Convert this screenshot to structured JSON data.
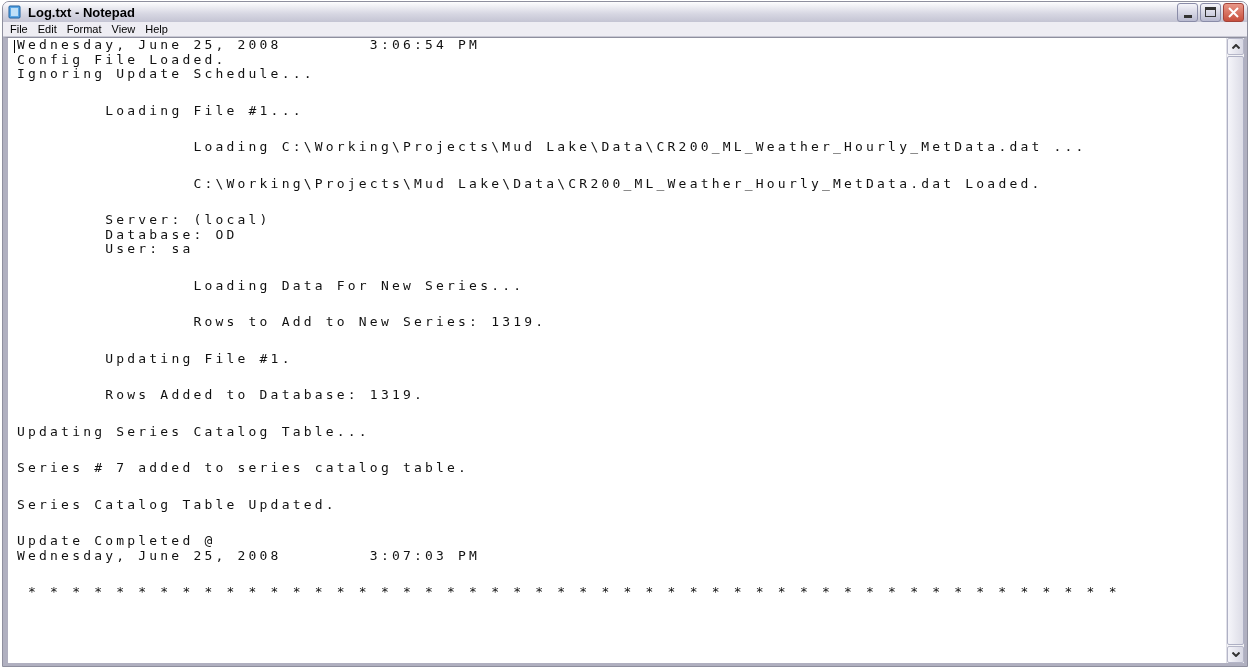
{
  "window": {
    "title": "Log.txt - Notepad"
  },
  "menu": [
    {
      "label": "File"
    },
    {
      "label": "Edit"
    },
    {
      "label": "Format"
    },
    {
      "label": "View"
    },
    {
      "label": "Help"
    }
  ],
  "document": {
    "paragraphs": [
      [
        "Wednesday, June 25, 2008\t3:06:54 PM",
        "Config File Loaded.",
        "Ignoring Update Schedule..."
      ],
      [
        "\tLoading File #1..."
      ],
      [
        "\t\tLoading C:\\Working\\Projects\\Mud Lake\\Data\\CR200_ML_Weather_Hourly_MetData.dat ..."
      ],
      [
        "\t\tC:\\Working\\Projects\\Mud Lake\\Data\\CR200_ML_Weather_Hourly_MetData.dat Loaded."
      ],
      [
        "\tServer: (local)",
        "\tDatabase: OD",
        "\tUser: sa"
      ],
      [
        "\t\tLoading Data For New Series..."
      ],
      [
        "\t\tRows to Add to New Series: 1319."
      ],
      [
        "\tUpdating File #1."
      ],
      [
        "\tRows Added to Database: 1319."
      ],
      [
        "Updating Series Catalog Table..."
      ],
      [
        "Series # 7 added to series catalog table."
      ],
      [
        "Series Catalog Table Updated."
      ],
      [
        "Update Completed @",
        "Wednesday, June 25, 2008\t3:07:03 PM"
      ],
      [
        " * * * * * * * * * * * * * * * * * * * * * * * * * * * * * * * * * * * * * * * * * * * * * * * * * *"
      ]
    ]
  }
}
